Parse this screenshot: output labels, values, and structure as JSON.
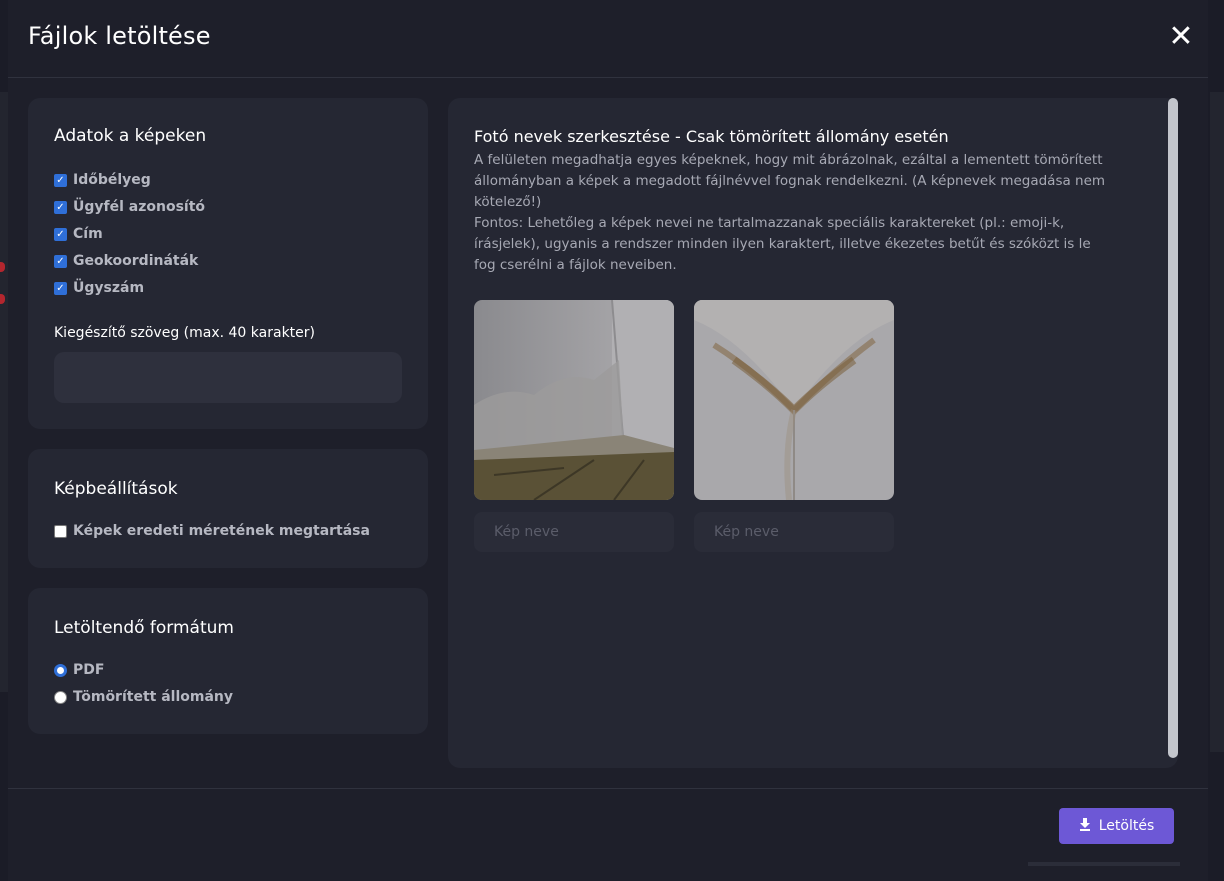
{
  "modal": {
    "title": "Fájlok letöltése",
    "close_icon": "close-icon"
  },
  "image_data": {
    "title": "Adatok a képeken",
    "checkboxes": [
      {
        "label": "Időbélyeg",
        "checked": true
      },
      {
        "label": "Ügyfél azonosító",
        "checked": true
      },
      {
        "label": "Cím",
        "checked": true
      },
      {
        "label": "Geokoordináták",
        "checked": true
      },
      {
        "label": "Ügyszám",
        "checked": true
      }
    ],
    "extra_text_label": "Kiegészítő szöveg (max. 40 karakter)",
    "extra_text_value": ""
  },
  "image_settings": {
    "title": "Képbeállítások",
    "keep_original_size": {
      "label": "Képek eredeti méretének megtartása",
      "checked": false
    }
  },
  "format": {
    "title": "Letöltendő formátum",
    "options": [
      {
        "label": "PDF",
        "selected": true
      },
      {
        "label": "Tömörített állomány",
        "selected": false
      }
    ]
  },
  "photo_names": {
    "title": "Fotó nevek szerkesztése - Csak tömörített állomány esetén",
    "description": "A felületen megadhatja egyes képeknek, hogy mit ábrázolnak, ezáltal a lementett tömörített állományban a képek a megadott fájlnévvel fognak rendelkezni. (A képnevek megadása nem kötelező!)",
    "warning": "Fontos: Lehetőleg a képek nevei ne tartalmazzanak speciális karaktereket (pl.: emoji-k, írásjelek), ugyanis a rendszer minden ilyen karaktert, illetve ékezetes betűt és szóközt is le fog cserélni a fájlok neveiben.",
    "photos": [
      {
        "placeholder": "Kép neve",
        "value": ""
      },
      {
        "placeholder": "Kép neve",
        "value": ""
      }
    ]
  },
  "footer": {
    "download_label": "Letöltés",
    "download_icon": "download-icon"
  },
  "colors": {
    "accent": "#6d58d6",
    "checkbox": "#2f6fd8",
    "background": "#1e1f2a",
    "card": "#252733"
  }
}
